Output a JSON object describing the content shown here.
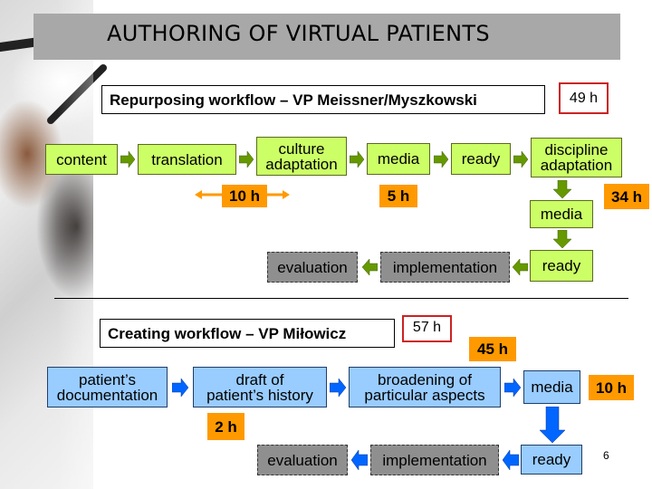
{
  "title": "AUTHORING OF VIRTUAL PATIENTS",
  "colors": {
    "repurpose_box": "#ccff66",
    "repurpose_arrow": "#669900",
    "create_box": "#99ccff",
    "create_arrow": "#0066ff",
    "pending_box": "#8f8f8f",
    "time_badge": "#ff9900",
    "total_border": "#cc2222",
    "title_bar": "#a8a8a8"
  },
  "repurposing": {
    "header": "Repurposing workflow – VP Meissner/Myszkowski",
    "total": "49 h",
    "steps": {
      "content": "content",
      "translation": "translation",
      "culture_line1": "culture",
      "culture_line2": "adaptation",
      "media": "media",
      "ready": "ready",
      "discipline_line1": "discipline",
      "discipline_line2": "adaptation",
      "media2": "media",
      "ready2": "ready",
      "implementation": "implementation",
      "evaluation": "evaluation"
    },
    "times": {
      "translation_culture": "10 h",
      "media": "5 h",
      "discipline": "34 h"
    }
  },
  "creating": {
    "header": "Creating workflow – VP Miłowicz",
    "total": "57 h",
    "steps": {
      "documentation_line1": "patient’s",
      "documentation_line2": "documentation",
      "draft_line1": "draft of",
      "draft_line2": "patient’s history",
      "broadening_line1": "broadening of",
      "broadening_line2": "particular aspects",
      "media": "media",
      "ready": "ready",
      "implementation": "implementation",
      "evaluation": "evaluation"
    },
    "times": {
      "draft": "2 h",
      "broadening": "45 h",
      "media": "10 h"
    }
  },
  "page_number": "6"
}
